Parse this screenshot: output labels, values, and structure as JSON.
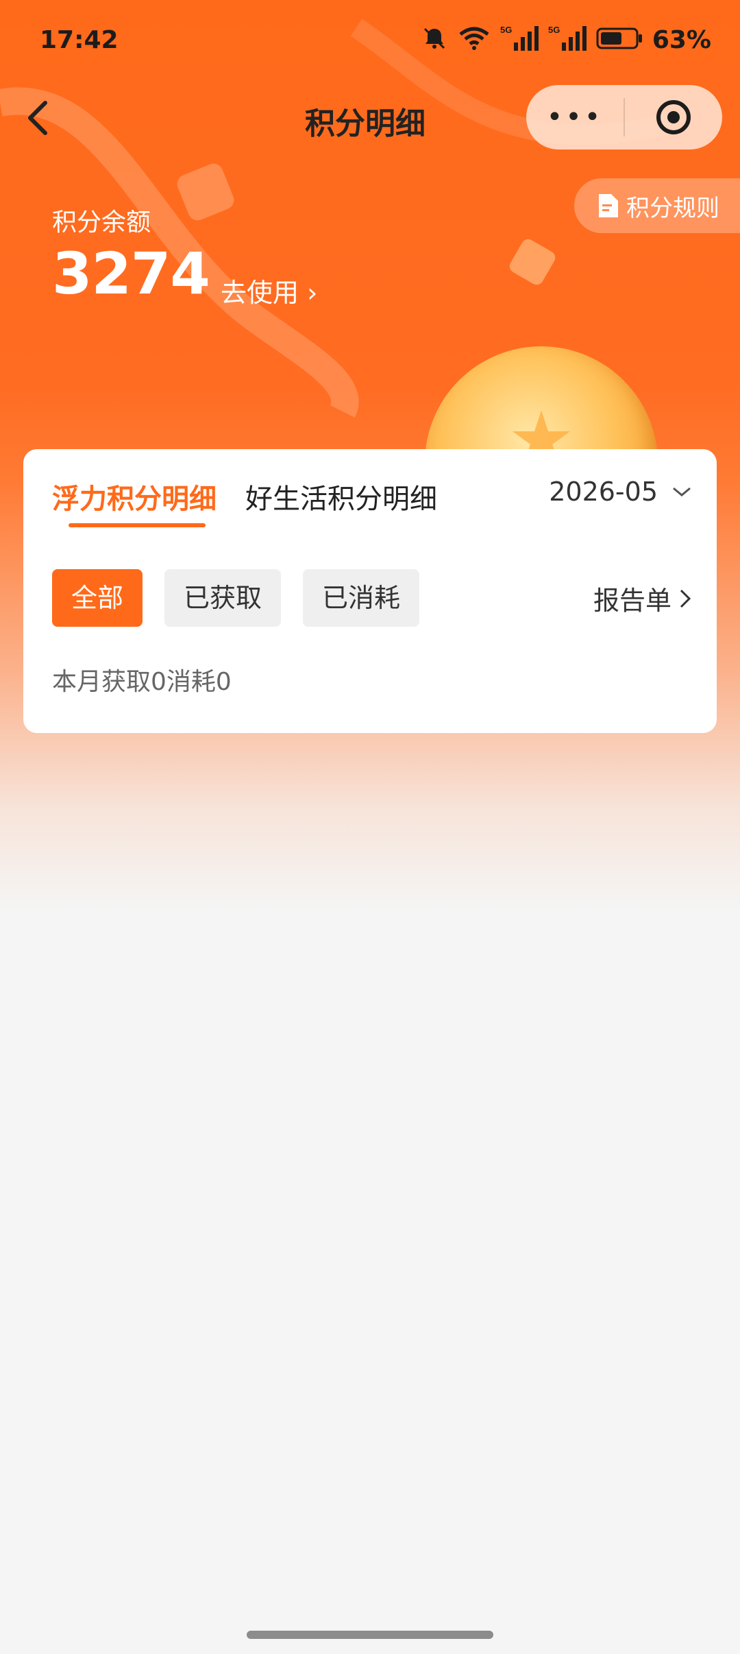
{
  "status_bar": {
    "time": "17:42",
    "network_1": "5G",
    "network_2": "5G",
    "battery": "63%"
  },
  "nav": {
    "title": "积分明细",
    "more_label": "•••"
  },
  "rules_button": "积分规则",
  "balance": {
    "label": "积分余额",
    "value": "3274",
    "use_link": "去使用"
  },
  "tabs": [
    {
      "label": "浮力积分明细",
      "active": true
    },
    {
      "label": "好生活积分明细",
      "active": false
    }
  ],
  "month_selector": "2026-05",
  "filters": [
    {
      "label": "全部",
      "active": true
    },
    {
      "label": "已获取",
      "active": false
    },
    {
      "label": "已消耗",
      "active": false
    }
  ],
  "report_link": "报告单",
  "monthly_summary": "本月获取0消耗0",
  "colors": {
    "accent": "#ff6a1a",
    "header_bg": "#ff6a1a",
    "page_bg": "#f5f5f5"
  }
}
